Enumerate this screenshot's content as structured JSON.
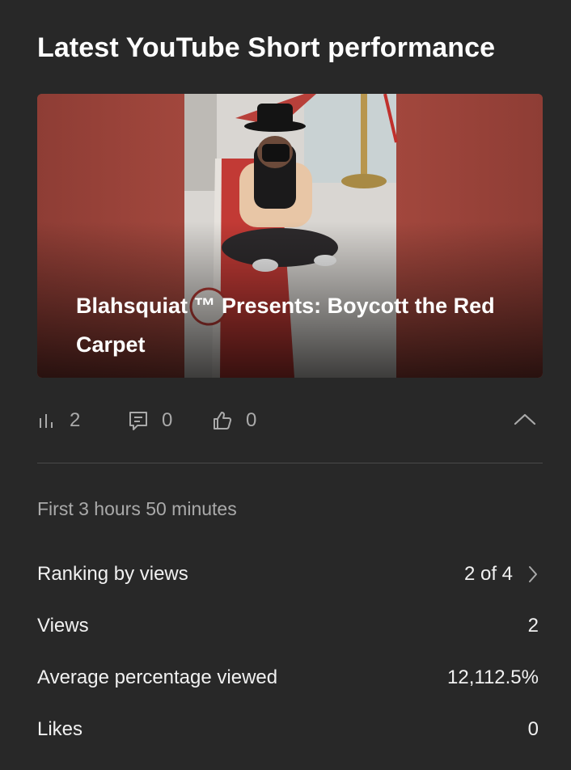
{
  "header": {
    "title": "Latest YouTube Short performance"
  },
  "video": {
    "title": "Blahsquiat ™ Presents: Boycott the Red Carpet"
  },
  "stats": {
    "views": "2",
    "comments": "0",
    "likes": "0"
  },
  "period": {
    "label": "First 3 hours 50 minutes"
  },
  "metrics": [
    {
      "label": "Ranking by views",
      "value": "2 of 4"
    },
    {
      "label": "Views",
      "value": "2"
    },
    {
      "label": "Average percentage viewed",
      "value": "12,112.5%"
    },
    {
      "label": "Likes",
      "value": "0"
    }
  ],
  "icons": {
    "views": "bar-chart-icon",
    "comments": "comment-icon",
    "likes": "thumbs-up-icon",
    "collapse": "chevron-up-icon",
    "ranking": "chevron-right-icon"
  },
  "colors": {
    "background": "#282828",
    "text_primary": "#f1f1f1",
    "text_secondary": "#aaaaaa",
    "divider": "#4a4a4a"
  }
}
